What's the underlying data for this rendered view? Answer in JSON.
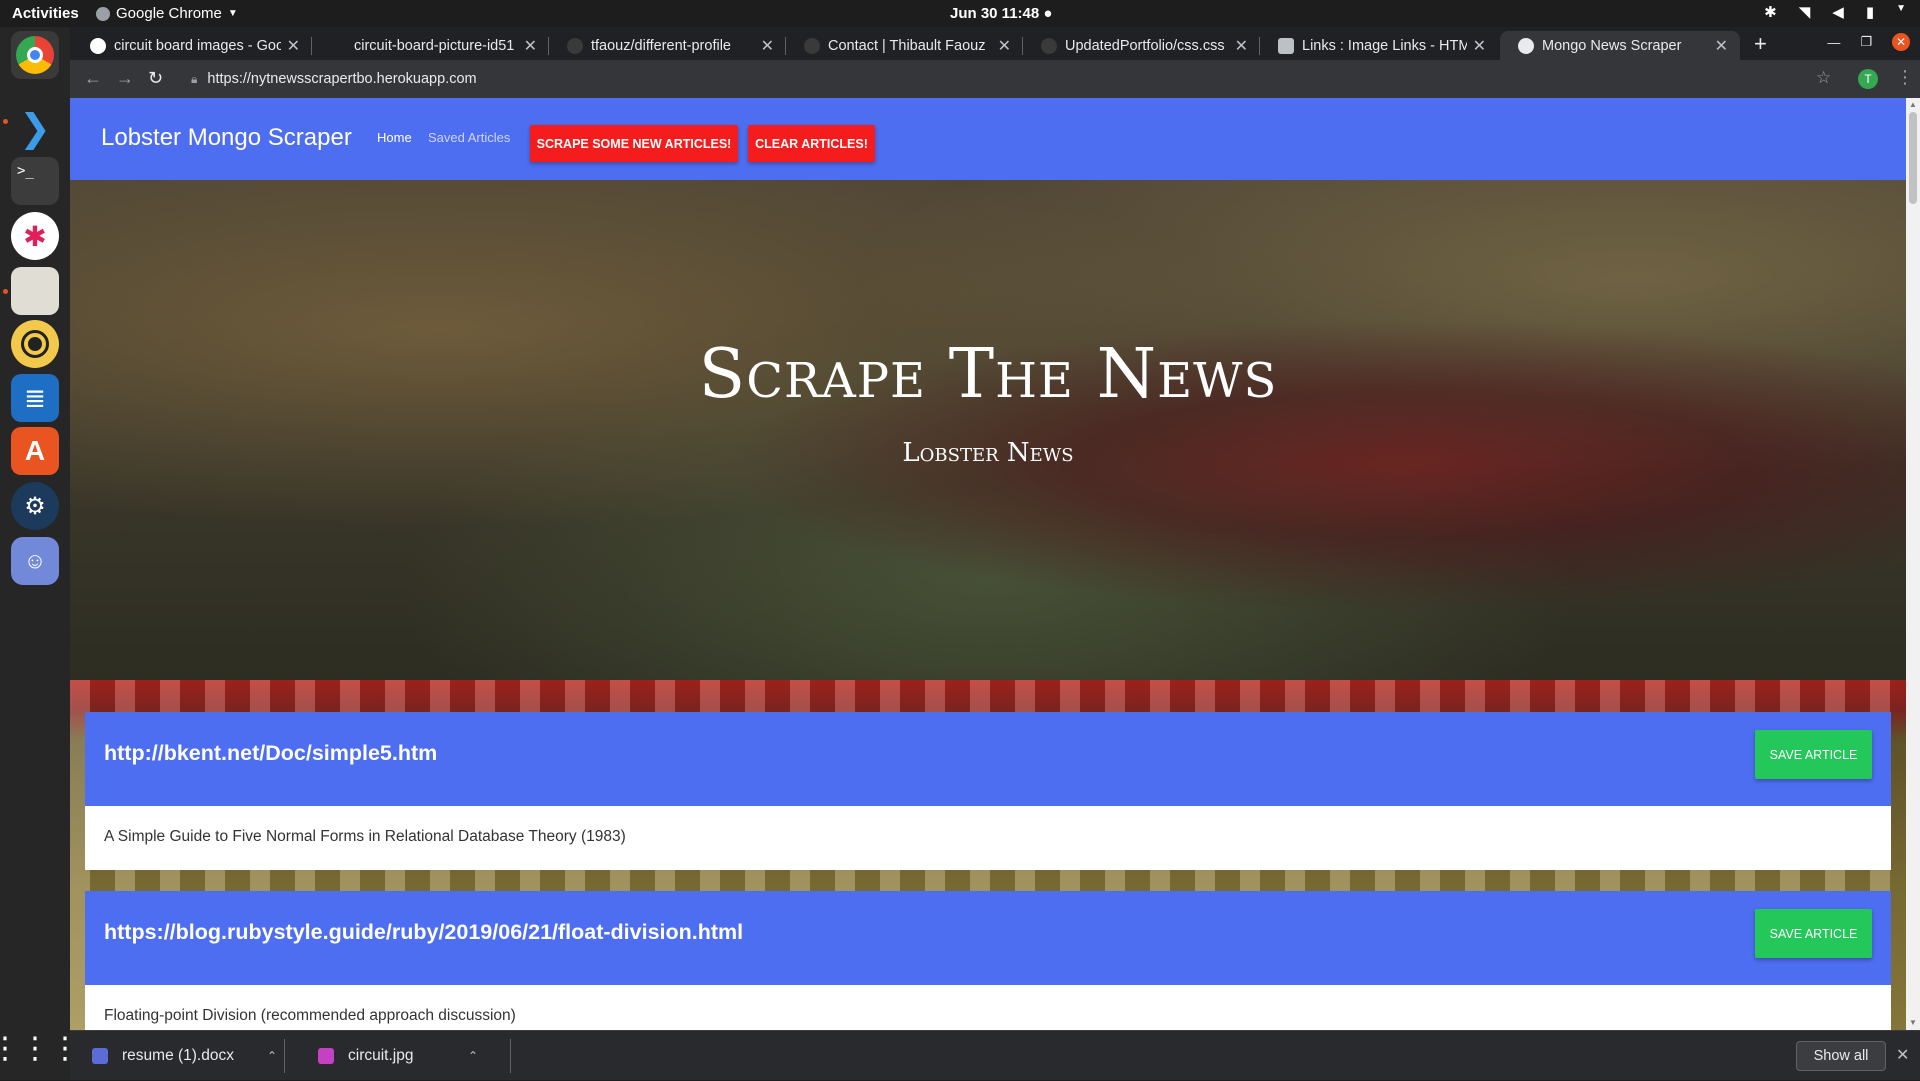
{
  "topbar": {
    "activities": "Activities",
    "app_name": "Google Chrome",
    "clock": "Jun 30  11:48 ●"
  },
  "tabs": [
    {
      "title": "circuit board images - Goo"
    },
    {
      "title": "circuit-board-picture-id51"
    },
    {
      "title": "tfaouz/different-profile"
    },
    {
      "title": "Contact | Thibault Faouz"
    },
    {
      "title": "UpdatedPortfolio/css.css"
    },
    {
      "title": "Links : Image Links - HTML"
    },
    {
      "title": "Mongo News Scraper"
    }
  ],
  "omnibox": {
    "url": "https://nytnewsscrapertbo.herokuapp.com",
    "avatar_letter": "T"
  },
  "page": {
    "brand": "Lobster Mongo Scraper",
    "nav_home": "Home",
    "nav_saved": "Saved Articles",
    "scrape_button": "SCRAPE SOME NEW ARTICLES!",
    "clear_button": "CLEAR ARTICLES!",
    "hero_title": "Scrape The News",
    "hero_subtitle": "Lobster News",
    "articles": [
      {
        "headline": "http://bkent.net/Doc/simple5.htm",
        "summary": "A Simple Guide to Five Normal Forms in Relational Database Theory (1983)",
        "save_label": "SAVE ARTICLE"
      },
      {
        "headline": "https://blog.rubystyle.guide/ruby/2019/06/21/float-division.html",
        "summary": "Floating-point Division (recommended approach discussion)",
        "save_label": "SAVE ARTICLE"
      }
    ]
  },
  "downloads": {
    "items": [
      {
        "name": "resume (1).docx"
      },
      {
        "name": "circuit.jpg"
      }
    ],
    "show_all": "Show all"
  },
  "colors": {
    "navbar": "#4e6ef2",
    "danger": "#f41c1c",
    "success": "#24c85a",
    "ubuntu_orange": "#e95420"
  }
}
